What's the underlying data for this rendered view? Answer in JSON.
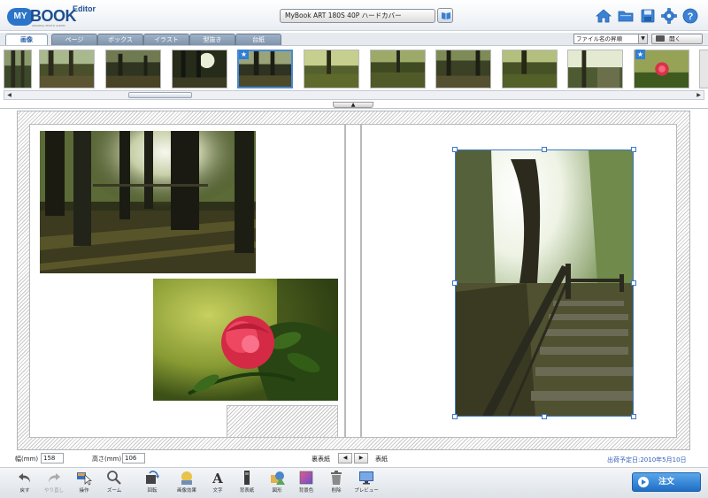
{
  "app": {
    "logo_my": "MY",
    "logo_book": "BOOK",
    "logo_editor": "Editor",
    "logo_sub": "ORIGINAL PHOTO ALBUM",
    "product_title": "MyBook ART 180S 40P ハードカバー"
  },
  "header_icons": [
    "home-icon",
    "folder-icon",
    "save-icon",
    "gear-icon",
    "help-icon"
  ],
  "tabs": [
    {
      "label": "画像",
      "active": true
    },
    {
      "label": "ページ",
      "active": false
    },
    {
      "label": "ボックス",
      "active": false
    },
    {
      "label": "イラスト",
      "active": false
    },
    {
      "label": "型抜き",
      "active": false
    },
    {
      "label": "台紙",
      "active": false
    }
  ],
  "sort_select": {
    "value": "ファイル名の昇順"
  },
  "open_button": {
    "label": "開く"
  },
  "thumbnails": [
    {
      "name": "thumb-1",
      "starred": false,
      "selected": false
    },
    {
      "name": "thumb-2",
      "starred": false,
      "selected": false
    },
    {
      "name": "thumb-3",
      "starred": false,
      "selected": false
    },
    {
      "name": "thumb-4",
      "starred": false,
      "selected": false
    },
    {
      "name": "thumb-5",
      "starred": true,
      "selected": true
    },
    {
      "name": "thumb-6",
      "starred": false,
      "selected": false
    },
    {
      "name": "thumb-7",
      "starred": false,
      "selected": false
    },
    {
      "name": "thumb-8",
      "starred": false,
      "selected": false
    },
    {
      "name": "thumb-9",
      "starred": false,
      "selected": false
    },
    {
      "name": "thumb-10",
      "starred": false,
      "selected": false
    },
    {
      "name": "thumb-11",
      "starred": true,
      "selected": false
    }
  ],
  "info": {
    "width_label": "幅(mm)",
    "width_value": "158",
    "height_label": "高さ(mm)",
    "height_value": "106",
    "back_cover_label": "裏表紙",
    "front_cover_label": "表紙",
    "ship_date": "出荷予定日:2010年5月10日"
  },
  "toolbar": {
    "undo": "戻す",
    "redo": "やり直し",
    "operate": "操作",
    "zoom": "ズーム",
    "rotate": "回転",
    "image_effect": "画像効果",
    "text": "文字",
    "back_paper": "背表紙",
    "shape": "図形",
    "bg_color": "背景色",
    "delete": "削除",
    "preview": "プレビュー",
    "order": "注文"
  }
}
